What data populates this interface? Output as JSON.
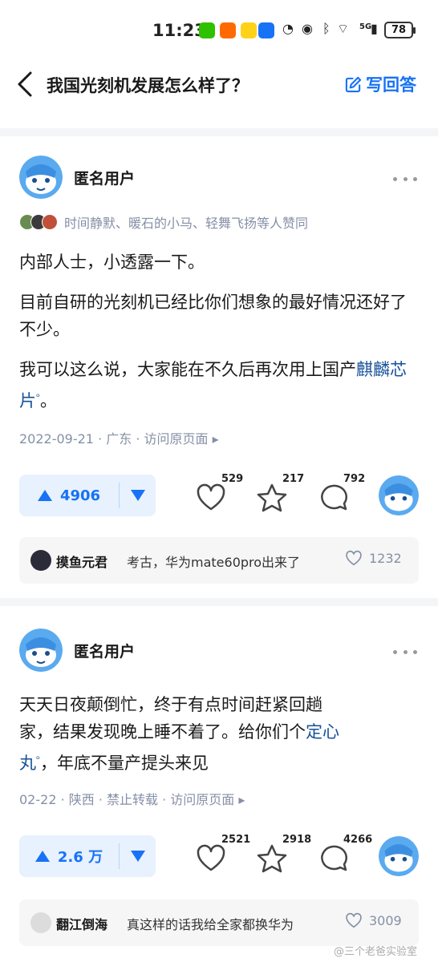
{
  "status_bar": {
    "time": "11:23",
    "battery": "78",
    "network": "5G"
  },
  "header": {
    "title": "我国光刻机发展怎么样了？",
    "write_answer": "写回答"
  },
  "answers": [
    {
      "author": "匿名用户",
      "likers_text": "时间静默、暖石的小马、轻舞飞扬等人赞同",
      "paragraphs": [
        "内部人士，小透露一下。",
        "目前自研的光刻机已经比你们想象的最好情况还好了不少。"
      ],
      "para3_prefix": "我可以这么说，大家能在不久后再次用上国产",
      "para3_link": "麒麟芯片",
      "para3_suffix": "。",
      "meta": "2022-09-21 · 广东 · 访问原页面 ▸",
      "vote_count": "4906",
      "like_count": "529",
      "fav_count": "217",
      "comment_count": "792",
      "top_comment": {
        "user": "摸鱼元君",
        "text": "考古，华为mate60pro出来了",
        "likes": "1232"
      }
    },
    {
      "author": "匿名用户",
      "line1": "天天日夜颠倒忙，终于有点时间赶紧回趟",
      "line2_prefix": "家，结果发现晚上睡不着了。给你们个",
      "line2_link": "定心",
      "line3_link": "丸",
      "line3_suffix": "，年底不量产提头来见",
      "meta": "02-22 · 陕西 · 禁止转载 · 访问原页面 ▸",
      "vote_count": "2.6 万",
      "like_count": "2521",
      "fav_count": "2918",
      "comment_count": "4266",
      "top_comment": {
        "user": "翻江倒海",
        "text": "真这样的话我给全家都换华为",
        "likes": "3009"
      }
    }
  ],
  "watermark": "@三个老爸实验室",
  "colors": {
    "accent": "#1772f6",
    "link": "#175199",
    "muted": "#8590a6"
  }
}
